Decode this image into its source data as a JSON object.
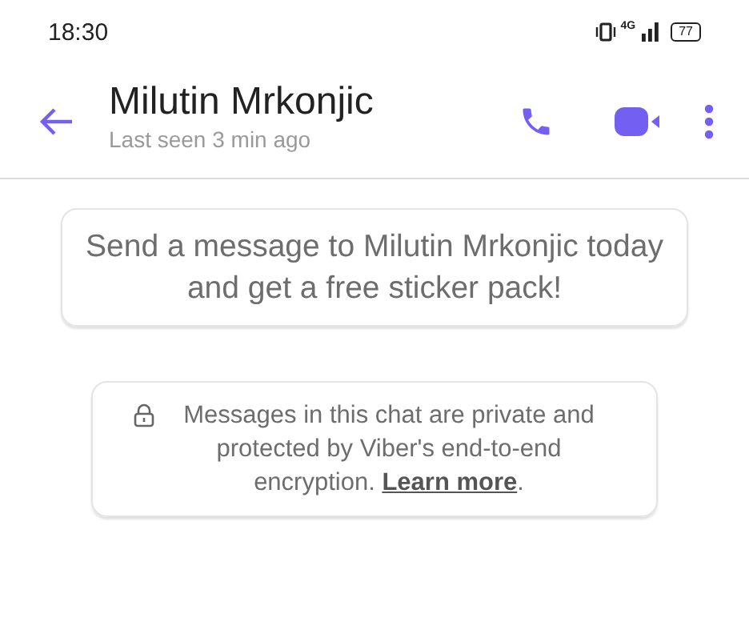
{
  "status_bar": {
    "time": "18:30",
    "network": "4G",
    "battery": "77"
  },
  "header": {
    "title": "Milutin Mrkonjic",
    "subtitle": "Last seen 3 min ago"
  },
  "messages": [
    {
      "kind": "promo",
      "text": "Send a message to Milutin Mrkonjic today and get a free sticker pack!"
    },
    {
      "kind": "encryption",
      "text": "Messages in this chat are private and protected by Viber's end-to-end encryption. ",
      "link": "Learn more",
      "after": "."
    }
  ]
}
